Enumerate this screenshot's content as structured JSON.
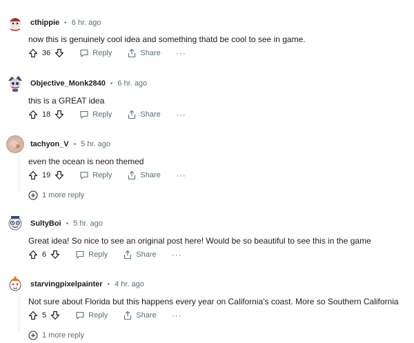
{
  "comments": [
    {
      "author": "cthippie",
      "time": "6 hr. ago",
      "text": "now this is genuinely cool idea and something thatd be cool to see in game.",
      "votes": "36",
      "reply": "Reply",
      "share": "Share",
      "more": "···",
      "more_replies": ""
    },
    {
      "author": "Objective_Monk2840",
      "time": "6 hr. ago",
      "text": "this is a GREAT idea",
      "votes": "18",
      "reply": "Reply",
      "share": "Share",
      "more": "···",
      "more_replies": ""
    },
    {
      "author": "tachyon_V",
      "time": "5 hr. ago",
      "text": "even the ocean is neon themed",
      "votes": "19",
      "reply": "Reply",
      "share": "Share",
      "more": "···",
      "more_replies": "1 more reply"
    },
    {
      "author": "SultyBoi",
      "time": "5 hr. ago",
      "text": "Great idea! So nice to see an original post here! Would be so beautiful to see this in the game",
      "votes": "6",
      "reply": "Reply",
      "share": "Share",
      "more": "···",
      "more_replies": ""
    },
    {
      "author": "starvingpixelpainter",
      "time": "4 hr. ago",
      "text": "Not sure about Florida but this happens every year on California's coast. More so Southern California",
      "votes": "5",
      "reply": "Reply",
      "share": "Share",
      "more": "···",
      "more_replies": "1 more reply"
    }
  ],
  "separator": "•"
}
